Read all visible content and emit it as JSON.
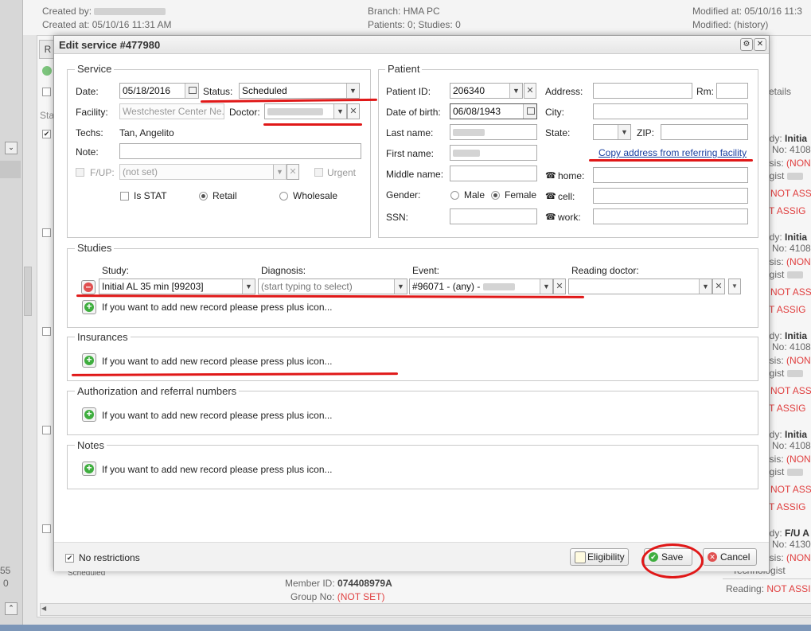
{
  "background": {
    "top_left": {
      "created_by_label": "Created by:",
      "created_at": "Created at: 05/10/16 11:31 AM"
    },
    "top_mid": {
      "branch": "Branch: HMA PC",
      "patients_studies": "Patients: 0; Studies: 0"
    },
    "top_right": {
      "modified_at": "Modified at: 05/10/16 11:3",
      "modified_by": "Modified: (history)"
    },
    "tab_letter": "R",
    "left_sta": "Sta",
    "right_details": "etails",
    "right_list": [
      {
        "l1": "udy:",
        "v1": "Initia",
        "l2": "No:",
        "v2": "4108",
        "l3": "osis:",
        "v3": "(NON",
        "l4": "ogist",
        "na1": "NOT ASSI",
        "na2": "T ASSIG"
      },
      {
        "l1": "udy:",
        "v1": "Initia",
        "l2": "No:",
        "v2": "4108",
        "l3": "osis:",
        "v3": "(NON",
        "l4": "ogist",
        "na1": "NOT ASSI",
        "na2": "T ASSIG"
      },
      {
        "l1": "udy:",
        "v1": "Initia",
        "l2": "No:",
        "v2": "4108",
        "l3": "osis:",
        "v3": "(NON",
        "l4": "ogist",
        "na1": "NOT ASSI",
        "na2": "T ASSIG"
      },
      {
        "l1": "udy:",
        "v1": "Initia",
        "l2": "No:",
        "v2": "4108",
        "l3": "osis:",
        "v3": "(NON",
        "l4": "ogist",
        "na1": "NOT ASSI",
        "na2": "T ASSIG"
      },
      {
        "l1": "udy:",
        "v1": "F/U A",
        "l2": "No:",
        "v2": "4130",
        "l3": "osis:",
        "v3": "(NON",
        "l4": "Technologist"
      }
    ],
    "reading_label": "Reading:",
    "reading_value": "NOT ASSI",
    "member_id_label": "Member ID:",
    "member_id_value": "074408979A",
    "group_no_label": "Group No:",
    "group_no_value": "(NOT SET)",
    "scheduled_text": "Scheduled",
    "left_numbers": [
      "55",
      "0"
    ]
  },
  "dialog": {
    "title": "Edit service #477980",
    "service": {
      "legend": "Service",
      "date_label": "Date:",
      "date_value": "05/18/2016",
      "status_label": "Status:",
      "status_value": "Scheduled",
      "facility_label": "Facility:",
      "facility_placeholder": "Westchester Center Ne...",
      "doctor_label": "Doctor:",
      "techs_label": "Techs:",
      "techs_value": "Tan, Angelito",
      "note_label": "Note:",
      "note_value": "",
      "fup_label": "F/UP:",
      "fup_placeholder": "(not set)",
      "urgent_label": "Urgent",
      "is_stat_label": "Is STAT",
      "retail_label": "Retail",
      "wholesale_label": "Wholesale"
    },
    "patient": {
      "legend": "Patient",
      "patient_id_label": "Patient ID:",
      "patient_id_value": "206340",
      "dob_label": "Date of birth:",
      "dob_value": "06/08/1943",
      "last_name_label": "Last name:",
      "first_name_label": "First name:",
      "middle_name_label": "Middle name:",
      "gender_label": "Gender:",
      "male_label": "Male",
      "female_label": "Female",
      "ssn_label": "SSN:",
      "address_label": "Address:",
      "rm_label": "Rm:",
      "city_label": "City:",
      "state_label": "State:",
      "zip_label": "ZIP:",
      "copy_address_link": "Copy address from referring facility",
      "home_label": "home:",
      "cell_label": "cell:",
      "work_label": "work:"
    },
    "studies": {
      "legend": "Studies",
      "col_study": "Study:",
      "col_diagnosis": "Diagnosis:",
      "col_event": "Event:",
      "col_reading_doctor": "Reading doctor:",
      "study_value": "Initial AL 35 min [99203]",
      "diagnosis_placeholder": "(start typing to select)",
      "event_value": "#96071 - (any) -",
      "add_hint": "If you want to add new record please press plus icon..."
    },
    "insurances": {
      "legend": "Insurances",
      "add_hint": "If you want to add new record please press plus icon..."
    },
    "authorization": {
      "legend": "Authorization and referral numbers",
      "add_hint": "If you want to add new record please press plus icon..."
    },
    "notes": {
      "legend": "Notes",
      "add_hint": "If you want to add new record please press plus icon..."
    },
    "footer": {
      "no_restrictions_label": "No restrictions",
      "eligibility_button": "Eligibility",
      "save_button": "Save",
      "cancel_button": "Cancel"
    }
  },
  "colors": {
    "annotation_red": "#e01818",
    "link_blue": "#1a3fa0",
    "not_assigned_red": "#e04040"
  }
}
